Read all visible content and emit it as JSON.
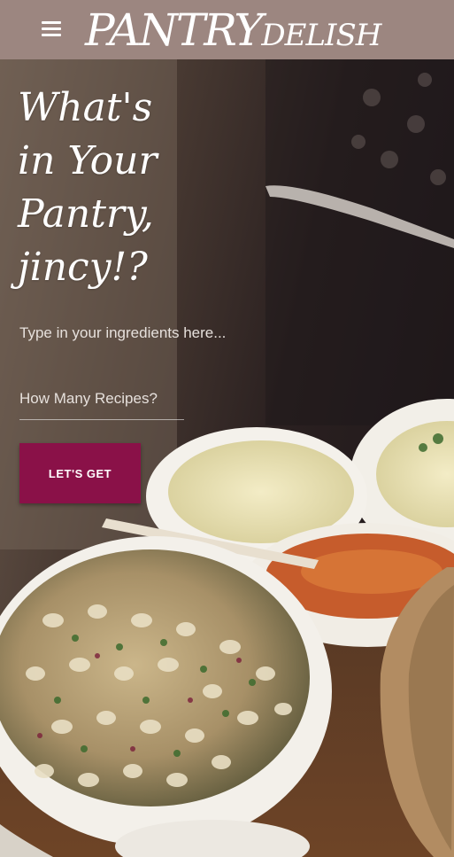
{
  "header": {
    "menu_icon": "hamburger-menu-icon",
    "brand_primary": "PANTRY",
    "brand_secondary": "DELISH"
  },
  "hero": {
    "headline_lines": [
      "What's",
      "in Your",
      "Pantry,",
      "jincy!?"
    ]
  },
  "form": {
    "ingredients_placeholder": "Type in your ingredients here...",
    "recipes_count_placeholder": "How Many Recipes?",
    "submit_label": "LET'S GET"
  },
  "colors": {
    "header_bg": "#9c8680",
    "button_bg": "#8a1148",
    "text": "#ffffff"
  }
}
